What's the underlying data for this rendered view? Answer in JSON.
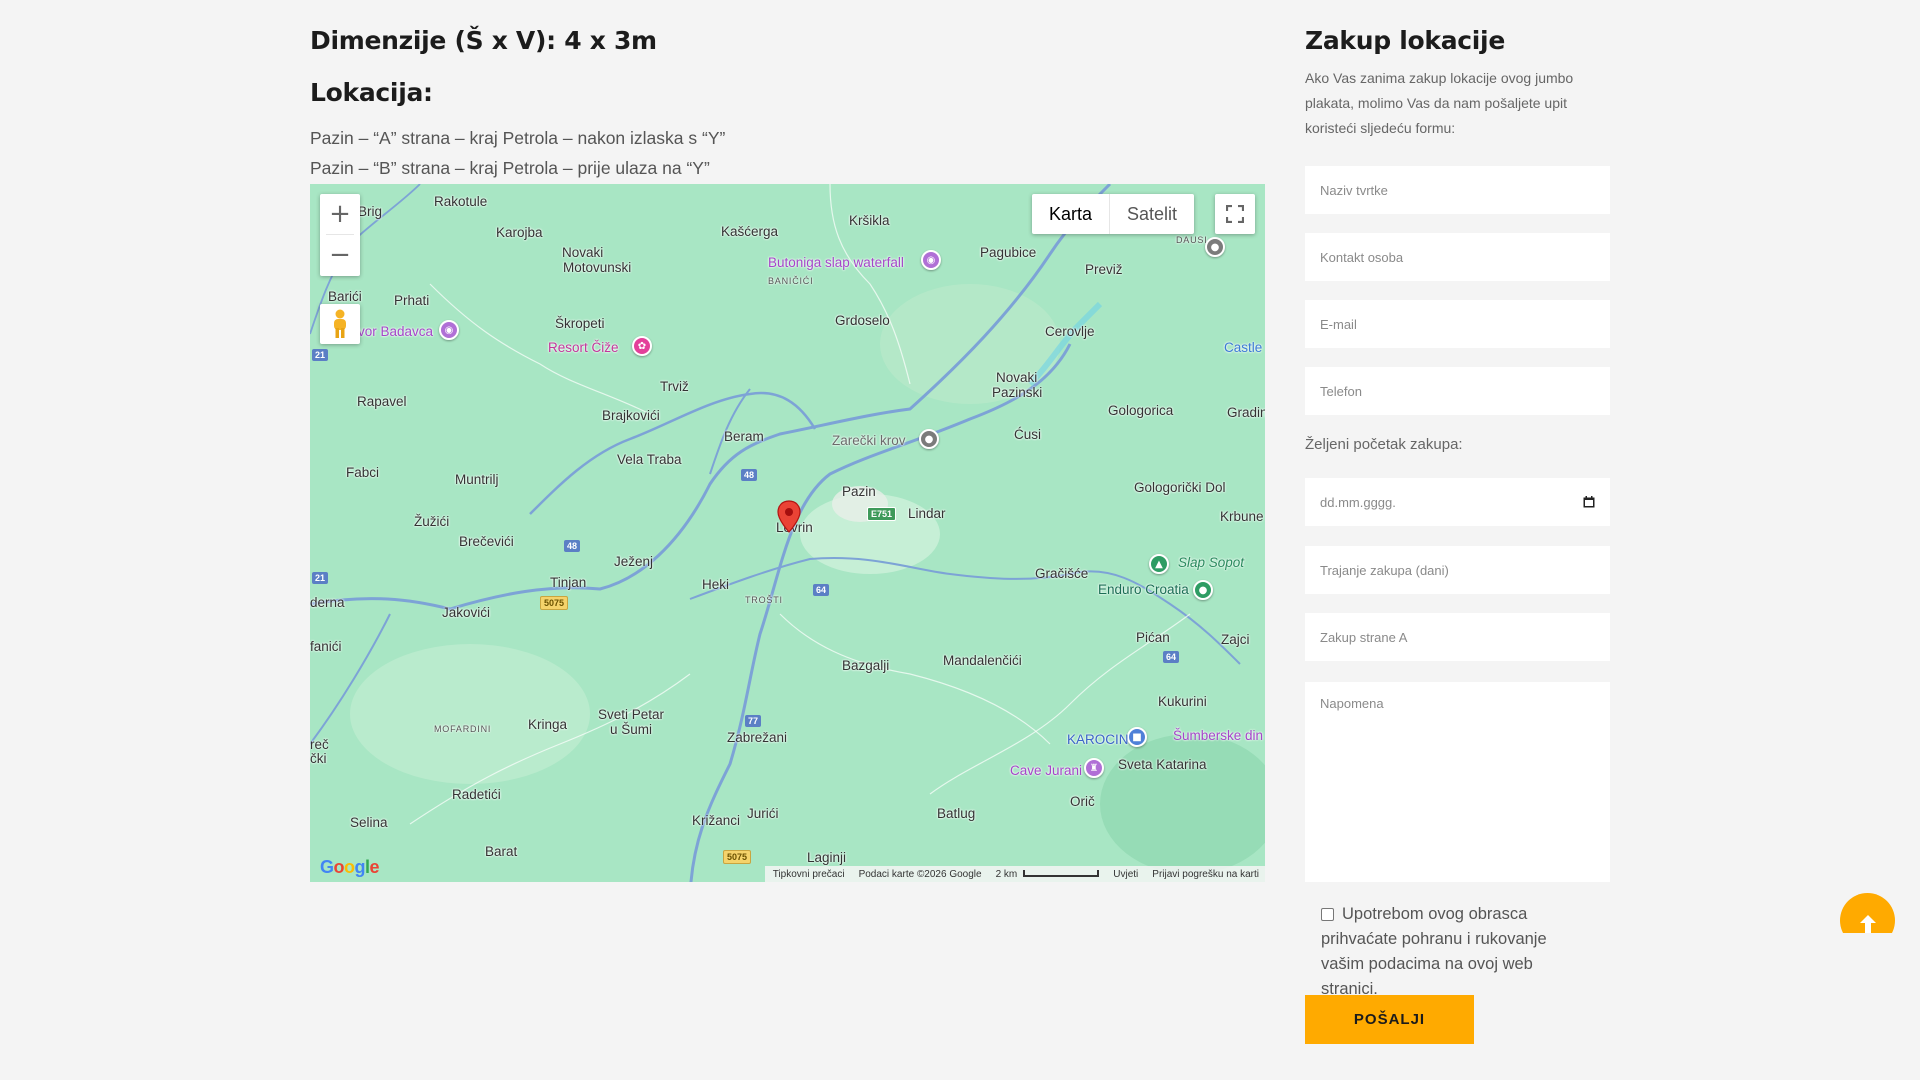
{
  "left": {
    "dimensions_heading": "Dimenzije (Š x V): 4 x 3m",
    "location_heading": "Lokacija:",
    "location_lines": [
      "Pazin – “A” strana – kraj Petrola – nakon izlaska s “Y”",
      "Pazin – “B” strana – kraj Petrola – prije ulaza na “Y”"
    ]
  },
  "map": {
    "map_type_buttons": [
      "Karta",
      "Satelit"
    ],
    "active_map_type": "Karta",
    "zoom_in": "+",
    "zoom_out": "−",
    "logo": "Google",
    "attribution": {
      "shortcuts": "Tipkovni prečaci",
      "data": "Podaci karte ©2026 Google",
      "scale": "2 km",
      "terms": "Uvjeti",
      "report": "Prijavi pogrešku na karti"
    },
    "places": [
      "Rakotule",
      "Brig",
      "Karojba",
      "Novaki",
      "Motovunski",
      "Kašćerga",
      "Kršikla",
      "Pagubice",
      "Previž",
      "DAUSI",
      "Barići",
      "Prhati",
      "Škropeti",
      "BANIČIĆI",
      "Grdoselo",
      "Cerovlje",
      "Castle",
      "Rapavel",
      "Trviž",
      "Brajkovići",
      "Novaki",
      "Pazinski",
      "Gologorica",
      "Gradin",
      "Beram",
      "Ćusi",
      "Vela Traba",
      "Fabci",
      "Muntrilj",
      "Pazin",
      "Gologorički Dol",
      "Lindar",
      "Lovrin",
      "Krbune",
      "Žužići",
      "Brečevići",
      "Ježenj",
      "Gračišće",
      "Tinjan",
      "Heki",
      "TROŠTI",
      "Jakovići",
      "derna",
      "Pićan",
      "Zajci",
      "fanići",
      "Bazgalji",
      "Mandalenčići",
      "Kukurini",
      "MOFARDINI",
      "Kringa",
      "Sveti Petar",
      "u Šumi",
      "Zabrežani",
      "Sveta Katarina",
      "reč",
      "čki",
      "Radetići",
      "Orič",
      "Selina",
      "Križanci",
      "Jurići",
      "Batlug",
      "Barat",
      "Laginji",
      "Kršikla"
    ],
    "pois": {
      "butoniga": "Butoniga slap waterfall",
      "badavca": "vor Badavca",
      "resort": "Resort Čiže",
      "zarecki": "Zarečki krov",
      "slap_sopot": "Slap Sopot",
      "enduro": "Enduro Croatia",
      "karocin": "KAROCIN",
      "cave": "Cave Jurani",
      "sumberske": "Šumberske din"
    },
    "road_shields": {
      "r21a": "21",
      "r48a": "48",
      "r48b": "48",
      "r21b": "21",
      "r5075a": "5075",
      "r64a": "64",
      "r64b": "64",
      "r77": "77",
      "r5075b": "5075",
      "e751": "E751"
    },
    "colors": {
      "land": "#a8e6c4",
      "roads": "#7da3d6",
      "purple_poi": "#a546c9",
      "pin_red": "#ea4335"
    }
  },
  "form": {
    "title": "Zakup lokacije",
    "description": "Ako Vas zanima zakup lokacije ovog jumbo plakata, molimo Vas da nam pošaljete upit koristeći sljedeću formu:",
    "company_placeholder": "Naziv tvrtke",
    "contact_placeholder": "Kontakt osoba",
    "email_placeholder": "E-mail",
    "phone_placeholder": "Telefon",
    "start_label": "Željeni početak zakupa:",
    "date_placeholder": "dd.mm.gggg.",
    "duration_placeholder": "Trajanje zakupa (dani)",
    "side_placeholder": "Zakup strane A",
    "note_placeholder": "Napomena",
    "consent_text": "Upotrebom ovog obrasca prihvaćate pohranu i rukovanje vašim podacima na ovoj web stranici.",
    "submit_label": "POŠALJI"
  },
  "colors": {
    "accent": "#ffaa00",
    "page_bg": "#f4f4f4"
  }
}
